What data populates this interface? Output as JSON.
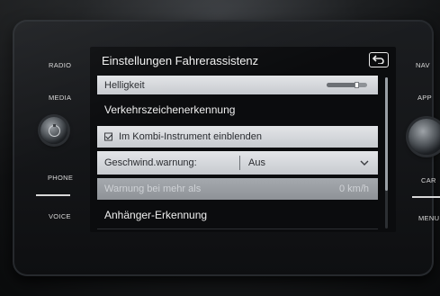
{
  "screen": {
    "title": "Einstellungen Fahrerassistenz",
    "rows": [
      {
        "label": "Helligkeit",
        "level": 0.75
      },
      {
        "label": "Verkehrszeichenerkennung"
      },
      {
        "label": "Im Kombi-Instrument einblenden",
        "checked": true
      },
      {
        "label": "Geschwind.warnung:",
        "value": "Aus"
      },
      {
        "label": "Warnung bei mehr als",
        "value": "0 km/h",
        "disabled": true
      },
      {
        "label": "Anhänger-Erkennung"
      }
    ],
    "scroll_visible_fraction": 0.75
  },
  "left_buttons": [
    "RADIO",
    "MEDIA",
    "PHONE",
    "VOICE"
  ],
  "right_buttons": [
    "NAV",
    "APP",
    "CAR",
    "MENU"
  ],
  "icons": {
    "back": "back-arrow-icon",
    "checkbox": "checkmark-icon",
    "dropdown": "chevron-down-icon",
    "knob": "power-knob-icon"
  },
  "colors": {
    "row_light": "#d7dadd",
    "row_dim": "#9a9ea3",
    "screen_bg": "#0b0c0e",
    "text_dark": "#2a2c30",
    "text_light": "#f0f0f0"
  }
}
